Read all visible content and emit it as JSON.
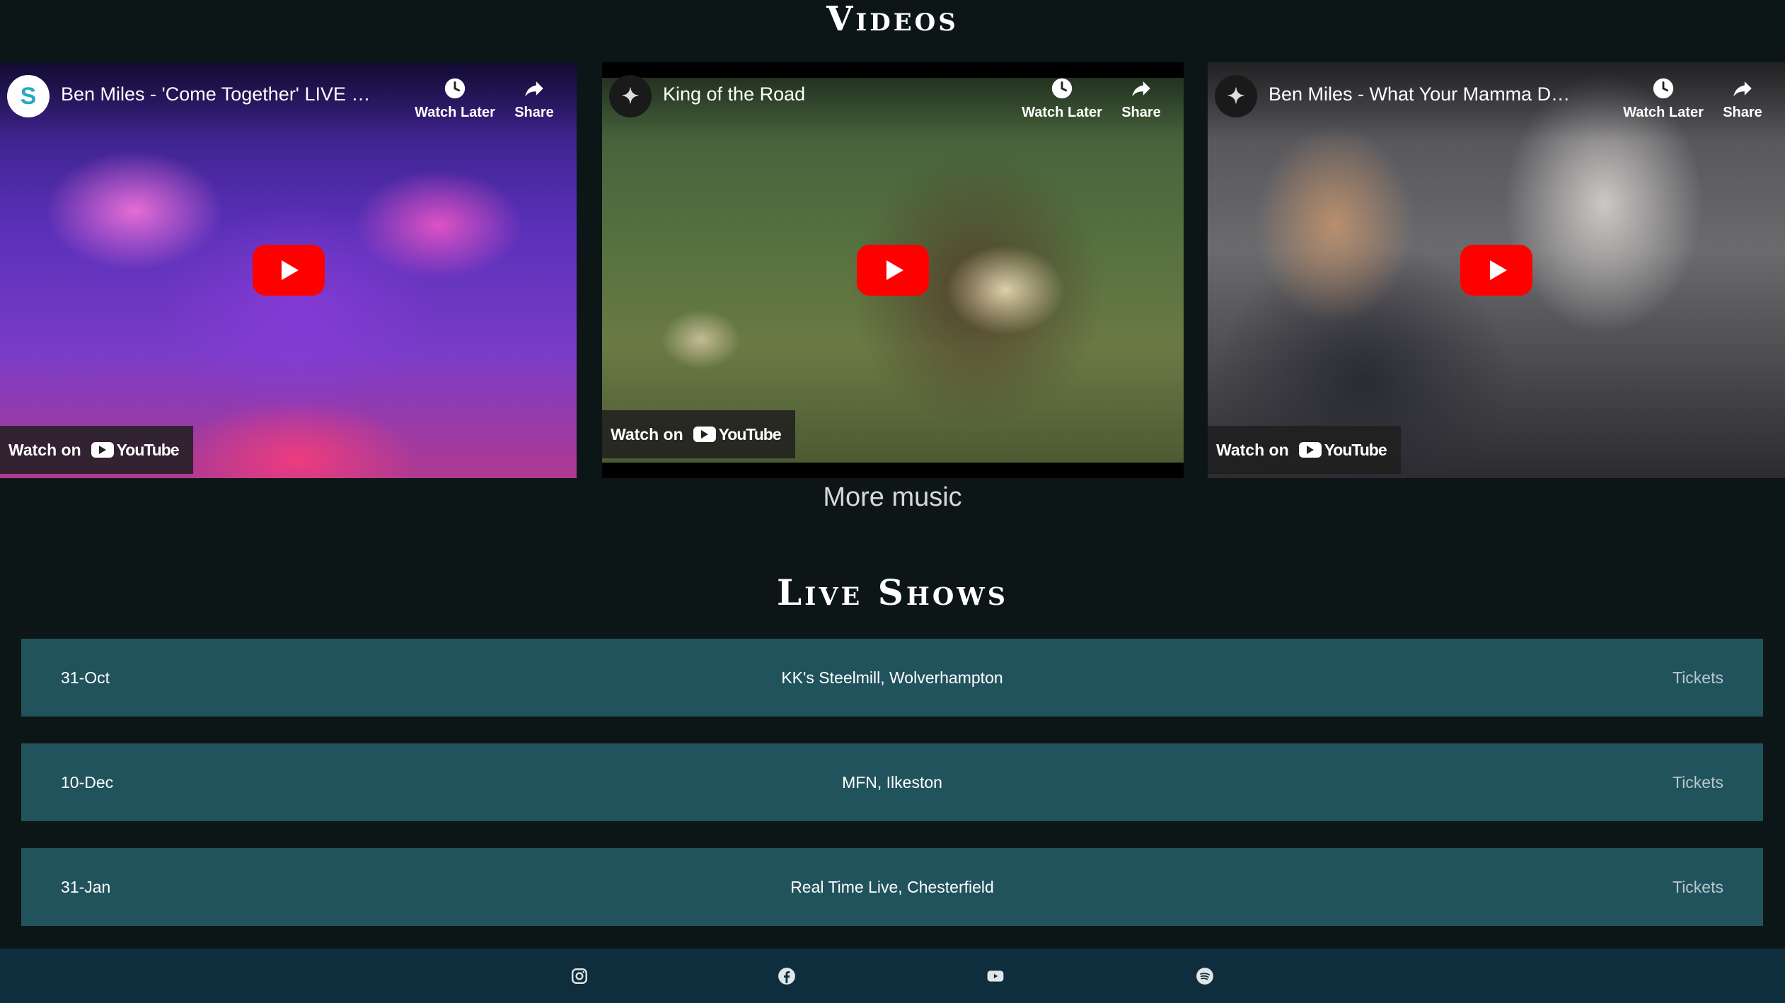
{
  "videos_section": {
    "title": "Videos",
    "items": [
      {
        "title": "Ben Miles - 'Come Together' LIVE at R...",
        "avatar": "S",
        "watch_later": "Watch Later",
        "share": "Share",
        "watch_on": "Watch on",
        "platform": "YouTube"
      },
      {
        "title": "King of the Road",
        "avatar": "✦",
        "watch_later": "Watch Later",
        "share": "Share",
        "watch_on": "Watch on",
        "platform": "YouTube"
      },
      {
        "title": "Ben Miles - What Your Mamma Don't ...",
        "avatar": "✦",
        "watch_later": "Watch Later",
        "share": "Share",
        "watch_on": "Watch on",
        "platform": "YouTube"
      }
    ],
    "more_link": "More music"
  },
  "shows_section": {
    "title": "Live Shows",
    "rows": [
      {
        "date": "31-Oct",
        "venue": "KK's Steelmill, Wolverhampton",
        "link": "Tickets"
      },
      {
        "date": "10-Dec",
        "venue": "MFN, Ilkeston",
        "link": "Tickets"
      },
      {
        "date": "31-Jan",
        "venue": "Real Time Live, Chesterfield",
        "link": "Tickets"
      }
    ]
  },
  "footer": {
    "icons": [
      "instagram-icon",
      "facebook-icon",
      "youtube-icon",
      "spotify-icon"
    ]
  },
  "colors": {
    "background": "#0d1616",
    "show_row": "#21535d",
    "footer": "#0f2e3d",
    "play_button": "#ff0000"
  }
}
